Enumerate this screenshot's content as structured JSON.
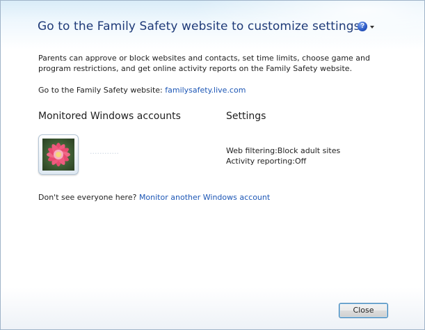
{
  "dialog": {
    "title": "Go to the Family Safety website to customize settings",
    "description": "Parents can approve or block websites and contacts, set time limits, choose game and program restrictions, and get online activity reports on the Family Safety website.",
    "website_prefix": "Go to the Family Safety website: ",
    "website_link": "familysafety.live.com",
    "help_icon": "?"
  },
  "accounts": {
    "header": "Monitored Windows accounts",
    "items": [
      {
        "name": "············",
        "avatar_icon": "flower-avatar-icon"
      }
    ]
  },
  "settings": {
    "header": "Settings",
    "web_filtering_label": "Web filtering:",
    "web_filtering_value": "Block adult sites",
    "activity_label": "Activity reporting:",
    "activity_value": "Off"
  },
  "footer": {
    "missing_prompt": "Don't see everyone here? ",
    "monitor_link": "Monitor another Windows account",
    "close_label": "Close"
  }
}
